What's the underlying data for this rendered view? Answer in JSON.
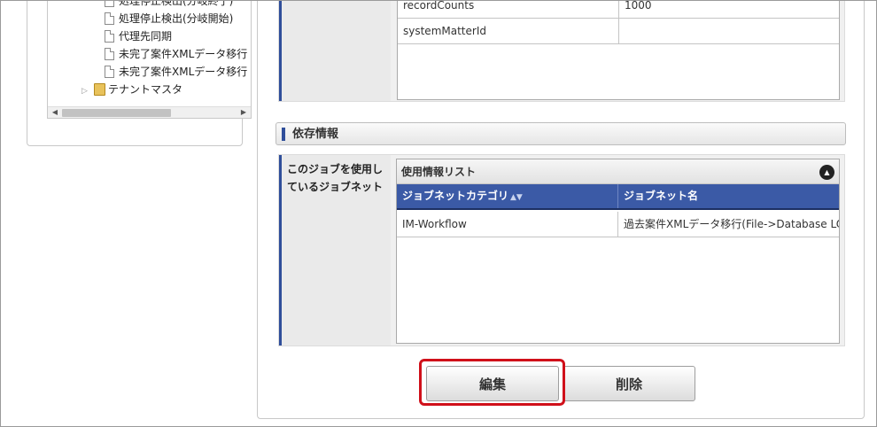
{
  "tree": {
    "items": [
      {
        "label": "処理停止検出(分岐終了)",
        "icon": "document-icon"
      },
      {
        "label": "処理停止検出(分岐開始)",
        "icon": "document-icon"
      },
      {
        "label": "代理先同期",
        "icon": "document-icon"
      },
      {
        "label": "未完了案件XMLデータ移行",
        "icon": "document-icon"
      },
      {
        "label": "未完了案件XMLデータ移行",
        "icon": "document-icon"
      }
    ],
    "folder": {
      "label": "テナントマスタ",
      "icon": "folder-icon"
    }
  },
  "params": {
    "rows": [
      {
        "name": "recordCounts",
        "value": "1000"
      },
      {
        "name": "systemMatterId",
        "value": ""
      }
    ]
  },
  "dependency": {
    "section_title": "依存情報",
    "label": "このジョブを使用しているジョブネット",
    "list": {
      "caption": "使用情報リスト",
      "columns": [
        "ジョブネットカテゴリ",
        "ジョブネット名"
      ],
      "rows": [
        {
          "category": "IM-Workflow",
          "name": "過去案件XMLデータ移行(File->Database LOB"
        }
      ]
    }
  },
  "actions": {
    "edit_label": "編集",
    "delete_label": "削除"
  },
  "colors": {
    "accent": "#2f4e9a",
    "header_bg": "#3b5aa6",
    "highlight": "#d0101a"
  }
}
